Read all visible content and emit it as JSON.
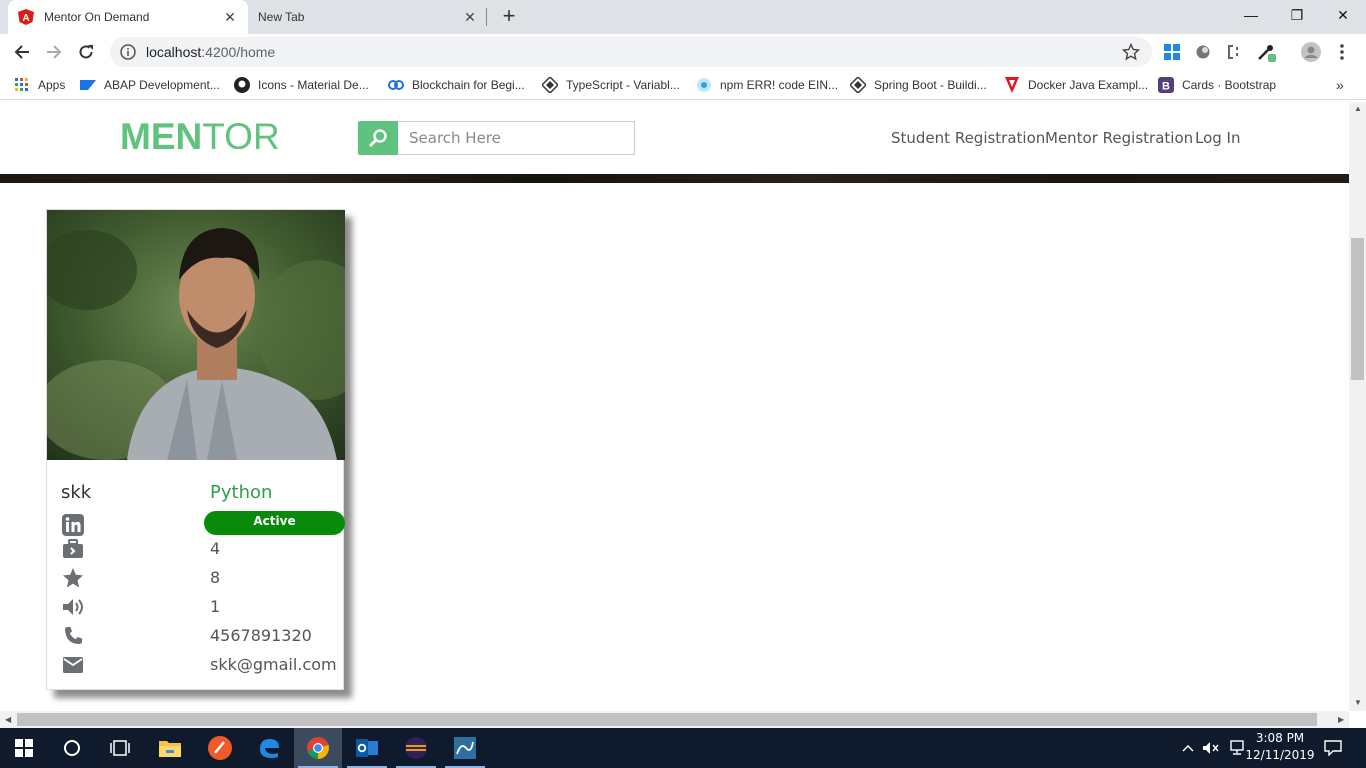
{
  "browser": {
    "tabs": [
      {
        "title": "Mentor On Demand",
        "active": true
      },
      {
        "title": "New Tab",
        "active": false
      }
    ],
    "url_host": "localhost",
    "url_path": ":4200/home",
    "bookmarks": [
      {
        "label": "Apps",
        "icon": "apps-grid-icon"
      },
      {
        "label": "ABAP Development...",
        "icon": "sap-icon"
      },
      {
        "label": "Icons - Material De...",
        "icon": "github-icon"
      },
      {
        "label": "Blockchain for Begi...",
        "icon": "chain-icon"
      },
      {
        "label": "TypeScript - Variabl...",
        "icon": "diamond-icon"
      },
      {
        "label": "npm ERR! code EIN...",
        "icon": "npm-icon"
      },
      {
        "label": "Spring Boot - Buildi...",
        "icon": "diamond-icon"
      },
      {
        "label": "Docker Java Exampl...",
        "icon": "docker-icon"
      },
      {
        "label": "Cards · Bootstrap",
        "icon": "bootstrap-icon"
      }
    ]
  },
  "site": {
    "logo_part1": "MEN",
    "logo_part2": "TOR",
    "search_placeholder": "Search Here",
    "nav": [
      "Student Registration",
      "Mentor Registration",
      "Log In"
    ],
    "accent": "#5fc27e"
  },
  "mentor_card": {
    "name": "skk",
    "skill": "Python",
    "status": "Active",
    "experience": "4",
    "rating": "8",
    "trainings": "1",
    "phone": "4567891320",
    "email": "skk@gmail.com"
  },
  "taskbar": {
    "time": "3:08 PM",
    "date": "12/11/2019"
  }
}
